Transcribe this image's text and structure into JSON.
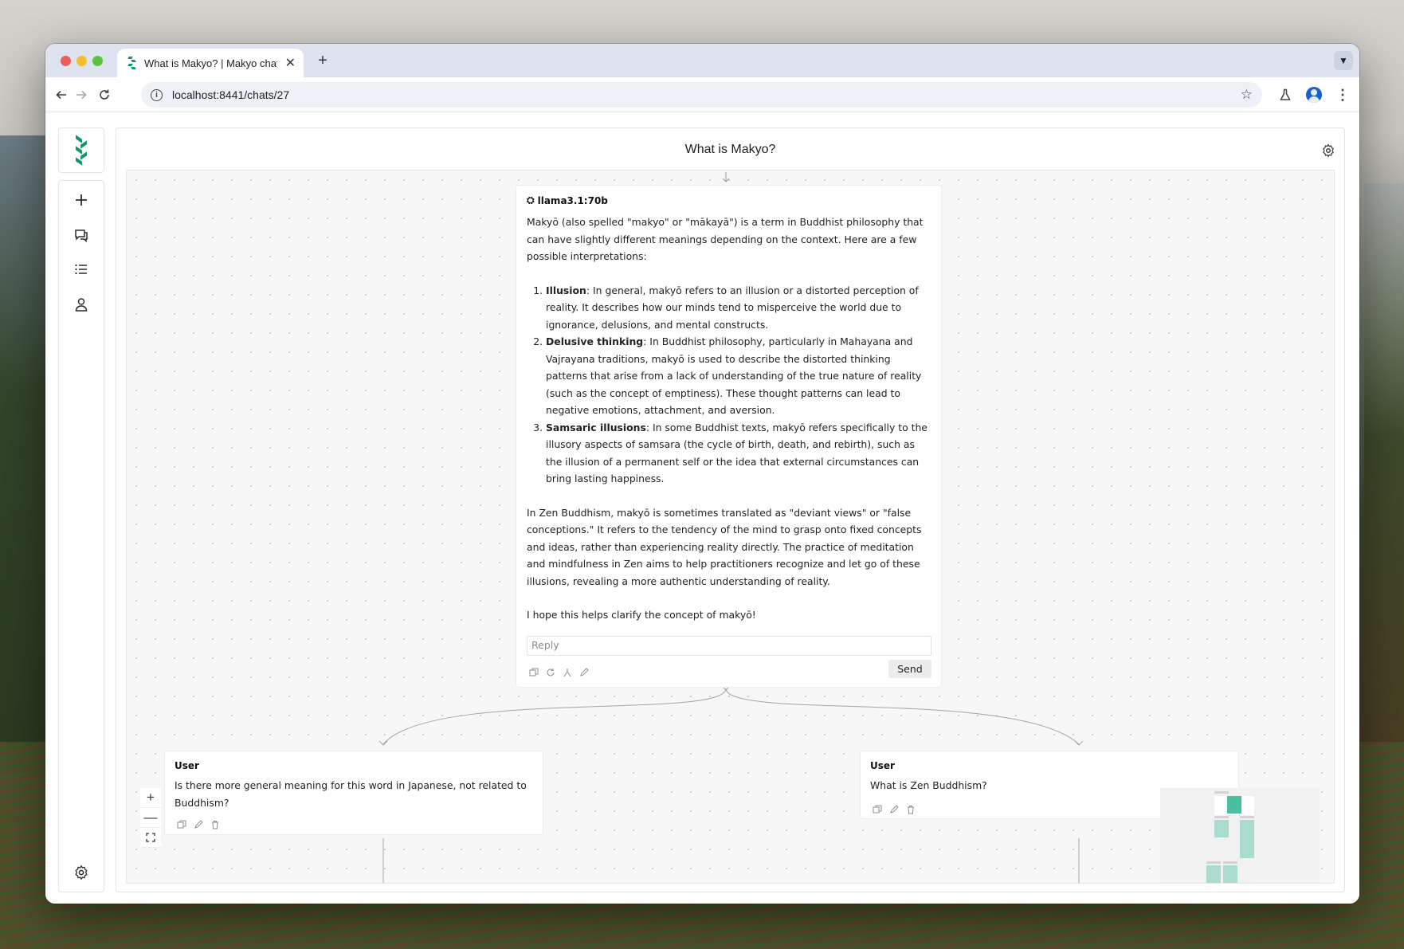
{
  "browser": {
    "tab_title": "What is Makyo? | Makyo chat",
    "url": "localhost:8441/chats/27"
  },
  "chat": {
    "title": "What is Makyo?"
  },
  "assistant_node": {
    "model": "llama3.1:70b",
    "intro": "Makyō (also spelled \"makyo\" or \"mākayā\") is a term in Buddhist philosophy that can have slightly different meanings depending on the context. Here are a few possible interpretations:",
    "items": [
      {
        "term": "Illusion",
        "text": ": In general, makyō refers to an illusion or a distorted perception of reality. It describes how our minds tend to misperceive the world due to ignorance, delusions, and mental constructs."
      },
      {
        "term": "Delusive thinking",
        "text": ": In Buddhist philosophy, particularly in Mahayana and Vajrayana traditions, makyō is used to describe the distorted thinking patterns that arise from a lack of understanding of the true nature of reality (such as the concept of emptiness). These thought patterns can lead to negative emotions, attachment, and aversion."
      },
      {
        "term": "Samsaric illusions",
        "text": ": In some Buddhist texts, makyō refers specifically to the illusory aspects of samsara (the cycle of birth, death, and rebirth), such as the illusion of a permanent self or the idea that external circumstances can bring lasting happiness."
      }
    ],
    "paragraph2": "In Zen Buddhism, makyō is sometimes translated as \"deviant views\" or \"false conceptions.\" It refers to the tendency of the mind to grasp onto fixed concepts and ideas, rather than experiencing reality directly. The practice of meditation and mindfulness in Zen aims to help practitioners recognize and let go of these illusions, revealing a more authentic understanding of reality.",
    "closing": "I hope this helps clarify the concept of makyō!",
    "reply_placeholder": "Reply",
    "send_label": "Send"
  },
  "user_nodes": [
    {
      "role": "User",
      "text": "Is there more general meaning for this word in Japanese, not related to Buddhism?"
    },
    {
      "role": "User",
      "text": "What is Zen Buddhism?"
    }
  ],
  "zoom": {
    "in": "+",
    "out": "—"
  },
  "colors": {
    "brand": "#12966a",
    "minimap_active": "#4cbfa0",
    "minimap_node": "#a9dccf"
  },
  "icons": {
    "sidebar": [
      "plus-icon",
      "chat-bubbles-icon",
      "list-icon",
      "user-icon",
      "settings-gear-icon"
    ],
    "node_actions": [
      "copy-icon",
      "refresh-icon",
      "branch-icon",
      "edit-icon",
      "trash-icon"
    ]
  }
}
